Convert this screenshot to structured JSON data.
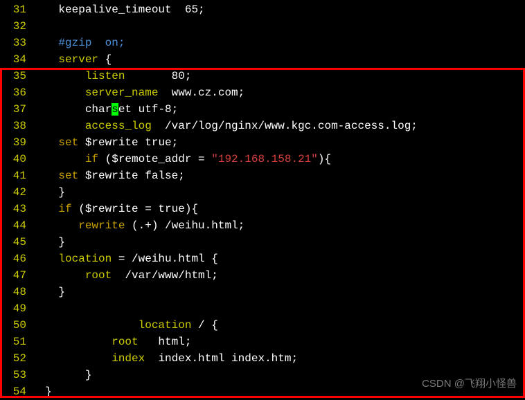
{
  "watermark": "CSDN @飞翔小怪兽",
  "lines": [
    {
      "num": "31",
      "segments": [
        {
          "t": "    keepalive_timeout  ",
          "c": "code"
        },
        {
          "t": "65",
          "c": "code"
        },
        {
          "t": ";",
          "c": "code"
        }
      ]
    },
    {
      "num": "32",
      "segments": [
        {
          "t": "",
          "c": "code"
        }
      ]
    },
    {
      "num": "33",
      "segments": [
        {
          "t": "    ",
          "c": "code"
        },
        {
          "t": "#gzip  on;",
          "c": "comment"
        }
      ]
    },
    {
      "num": "34",
      "segments": [
        {
          "t": "    ",
          "c": "code"
        },
        {
          "t": "server",
          "c": "keyword"
        },
        {
          "t": " {",
          "c": "brace"
        }
      ]
    },
    {
      "num": "35",
      "segments": [
        {
          "t": "        ",
          "c": "code"
        },
        {
          "t": "listen",
          "c": "keyword"
        },
        {
          "t": "       ",
          "c": "code"
        },
        {
          "t": "80",
          "c": "code"
        },
        {
          "t": ";",
          "c": "code"
        }
      ]
    },
    {
      "num": "36",
      "segments": [
        {
          "t": "        ",
          "c": "code"
        },
        {
          "t": "server_name",
          "c": "keyword"
        },
        {
          "t": "  www.cz.com;",
          "c": "code"
        }
      ]
    },
    {
      "num": "37",
      "segments": [
        {
          "t": "        char",
          "c": "code"
        },
        {
          "t": "s",
          "c": "cursor"
        },
        {
          "t": "et utf-8;",
          "c": "code"
        }
      ]
    },
    {
      "num": "38",
      "segments": [
        {
          "t": "        ",
          "c": "code"
        },
        {
          "t": "access_log",
          "c": "keyword"
        },
        {
          "t": "  /var/log/nginx/www.kgc.com-access.log;",
          "c": "code"
        }
      ]
    },
    {
      "num": "39",
      "segments": [
        {
          "t": "    ",
          "c": "code"
        },
        {
          "t": "set",
          "c": "statement"
        },
        {
          "t": " $rewrite true;",
          "c": "code"
        }
      ]
    },
    {
      "num": "40",
      "segments": [
        {
          "t": "        ",
          "c": "code"
        },
        {
          "t": "if",
          "c": "statement"
        },
        {
          "t": " ($remote_addr = ",
          "c": "code"
        },
        {
          "t": "\"192.168.158.21\"",
          "c": "string"
        },
        {
          "t": "){",
          "c": "code"
        }
      ]
    },
    {
      "num": "41",
      "segments": [
        {
          "t": "    ",
          "c": "code"
        },
        {
          "t": "set",
          "c": "statement"
        },
        {
          "t": " $rewrite false;",
          "c": "code"
        }
      ]
    },
    {
      "num": "42",
      "segments": [
        {
          "t": "    }",
          "c": "brace"
        }
      ]
    },
    {
      "num": "43",
      "segments": [
        {
          "t": "    ",
          "c": "code"
        },
        {
          "t": "if",
          "c": "statement"
        },
        {
          "t": " ($rewrite = true){",
          "c": "code"
        }
      ]
    },
    {
      "num": "44",
      "segments": [
        {
          "t": "       ",
          "c": "code"
        },
        {
          "t": "rewrite",
          "c": "statement"
        },
        {
          "t": " (.+) /weihu.html;",
          "c": "code"
        }
      ]
    },
    {
      "num": "45",
      "segments": [
        {
          "t": "    }",
          "c": "brace"
        }
      ]
    },
    {
      "num": "46",
      "segments": [
        {
          "t": "    ",
          "c": "code"
        },
        {
          "t": "location",
          "c": "keyword"
        },
        {
          "t": " = /weihu.html {",
          "c": "code"
        }
      ]
    },
    {
      "num": "47",
      "segments": [
        {
          "t": "        ",
          "c": "code"
        },
        {
          "t": "root",
          "c": "keyword"
        },
        {
          "t": "  /var/www/html;",
          "c": "code"
        }
      ]
    },
    {
      "num": "48",
      "segments": [
        {
          "t": "    }",
          "c": "brace"
        }
      ]
    },
    {
      "num": "49",
      "segments": [
        {
          "t": "",
          "c": "code"
        }
      ]
    },
    {
      "num": "50",
      "segments": [
        {
          "t": "                ",
          "c": "code"
        },
        {
          "t": "location",
          "c": "keyword"
        },
        {
          "t": " / {",
          "c": "code"
        }
      ]
    },
    {
      "num": "51",
      "segments": [
        {
          "t": "            ",
          "c": "code"
        },
        {
          "t": "root",
          "c": "keyword"
        },
        {
          "t": "   html;",
          "c": "code"
        }
      ]
    },
    {
      "num": "52",
      "segments": [
        {
          "t": "            ",
          "c": "code"
        },
        {
          "t": "index",
          "c": "keyword"
        },
        {
          "t": "  index.html index.htm;",
          "c": "code"
        }
      ]
    },
    {
      "num": "53",
      "segments": [
        {
          "t": "        }",
          "c": "brace"
        }
      ]
    },
    {
      "num": "54",
      "segments": [
        {
          "t": "  }",
          "c": "brace"
        }
      ]
    }
  ]
}
